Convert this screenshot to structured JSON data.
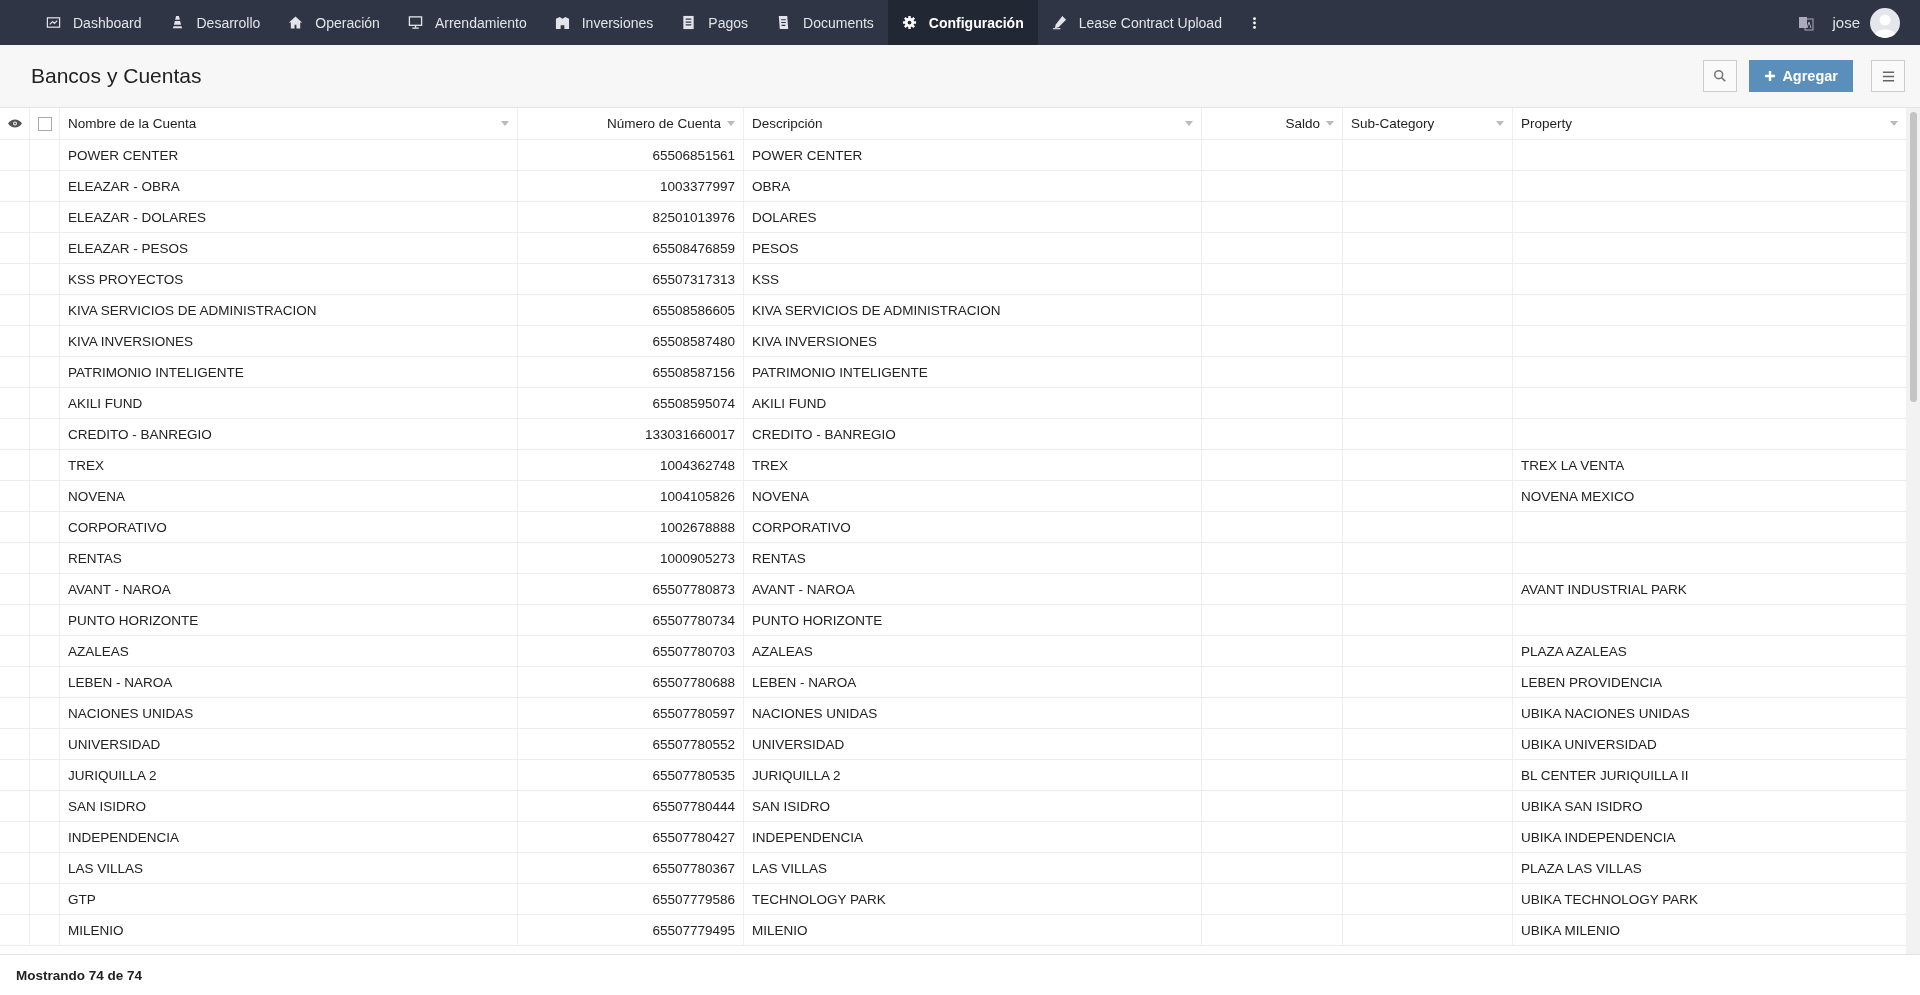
{
  "nav": {
    "items": [
      {
        "label": "Dashboard",
        "selected": false
      },
      {
        "label": "Desarrollo",
        "selected": false
      },
      {
        "label": "Operación",
        "selected": false
      },
      {
        "label": "Arrendamiento",
        "selected": false
      },
      {
        "label": "Inversiones",
        "selected": false
      },
      {
        "label": "Pagos",
        "selected": false
      },
      {
        "label": "Documents",
        "selected": false
      },
      {
        "label": "Configuración",
        "selected": true
      },
      {
        "label": "Lease Contract Upload",
        "selected": false
      }
    ],
    "user": "jose"
  },
  "page": {
    "title": "Bancos y Cuentas",
    "add_button": "Agregar"
  },
  "table": {
    "select_all": {
      "checked": false
    },
    "columns": [
      "Nombre de la Cuenta",
      "Número de Cuenta",
      "Descripción",
      "Saldo",
      "Sub-Category",
      "Property"
    ],
    "rows": [
      {
        "name": "POWER CENTER",
        "number": "65506851561",
        "description": "POWER CENTER"
      },
      {
        "name": "ELEAZAR - OBRA",
        "number": "1003377997",
        "description": "OBRA"
      },
      {
        "name": "ELEAZAR - DOLARES",
        "number": "82501013976",
        "description": "DOLARES"
      },
      {
        "name": "ELEAZAR - PESOS",
        "number": "65508476859",
        "description": "PESOS"
      },
      {
        "name": "KSS PROYECTOS",
        "number": "65507317313",
        "description": "KSS"
      },
      {
        "name": "KIVA SERVICIOS DE ADMINISTRACION",
        "number": "65508586605",
        "description": "KIVA SERVICIOS DE ADMINISTRACION"
      },
      {
        "name": "KIVA INVERSIONES",
        "number": "65508587480",
        "description": "KIVA INVERSIONES"
      },
      {
        "name": "PATRIMONIO INTELIGENTE",
        "number": "65508587156",
        "description": "PATRIMONIO INTELIGENTE"
      },
      {
        "name": "AKILI FUND",
        "number": "65508595074",
        "description": "AKILI FUND"
      },
      {
        "name": "CREDITO - BANREGIO",
        "number": "133031660017",
        "description": "CREDITO - BANREGIO"
      },
      {
        "name": "TREX",
        "number": "1004362748",
        "description": "TREX",
        "property": "TREX LA VENTA"
      },
      {
        "name": "NOVENA",
        "number": "1004105826",
        "description": "NOVENA",
        "property": "NOVENA MEXICO"
      },
      {
        "name": "CORPORATIVO",
        "number": "1002678888",
        "description": "CORPORATIVO"
      },
      {
        "name": "RENTAS",
        "number": "1000905273",
        "description": "RENTAS"
      },
      {
        "name": "AVANT - NAROA",
        "number": "65507780873",
        "description": "AVANT - NAROA",
        "property": "AVANT INDUSTRIAL PARK"
      },
      {
        "name": "PUNTO HORIZONTE",
        "number": "65507780734",
        "description": "PUNTO HORIZONTE"
      },
      {
        "name": "AZALEAS",
        "number": "65507780703",
        "description": "AZALEAS",
        "property": "PLAZA AZALEAS"
      },
      {
        "name": "LEBEN - NAROA",
        "number": "65507780688",
        "description": "LEBEN - NAROA",
        "property": "LEBEN PROVIDENCIA"
      },
      {
        "name": "NACIONES UNIDAS",
        "number": "65507780597",
        "description": "NACIONES UNIDAS",
        "property": "UBIKA NACIONES UNIDAS"
      },
      {
        "name": "UNIVERSIDAD",
        "number": "65507780552",
        "description": "UNIVERSIDAD",
        "property": "UBIKA UNIVERSIDAD"
      },
      {
        "name": "JURIQUILLA 2",
        "number": "65507780535",
        "description": "JURIQUILLA 2",
        "property": "BL CENTER JURIQUILLA II"
      },
      {
        "name": "SAN ISIDRO",
        "number": "65507780444",
        "description": "SAN ISIDRO",
        "property": "UBIKA SAN ISIDRO"
      },
      {
        "name": "INDEPENDENCIA",
        "number": "65507780427",
        "description": "INDEPENDENCIA",
        "property": "UBIKA INDEPENDENCIA"
      },
      {
        "name": "LAS VILLAS",
        "number": "65507780367",
        "description": "LAS VILLAS",
        "property": "PLAZA LAS VILLAS"
      },
      {
        "name": "GTP",
        "number": "65507779586",
        "description": "TECHNOLOGY PARK",
        "property": "UBIKA TECHNOLOGY PARK"
      },
      {
        "name": "MILENIO",
        "number": "65507779495",
        "description": "MILENIO",
        "property": "UBIKA MILENIO"
      }
    ]
  },
  "footer": {
    "count": "Mostrando 74 de 74"
  }
}
